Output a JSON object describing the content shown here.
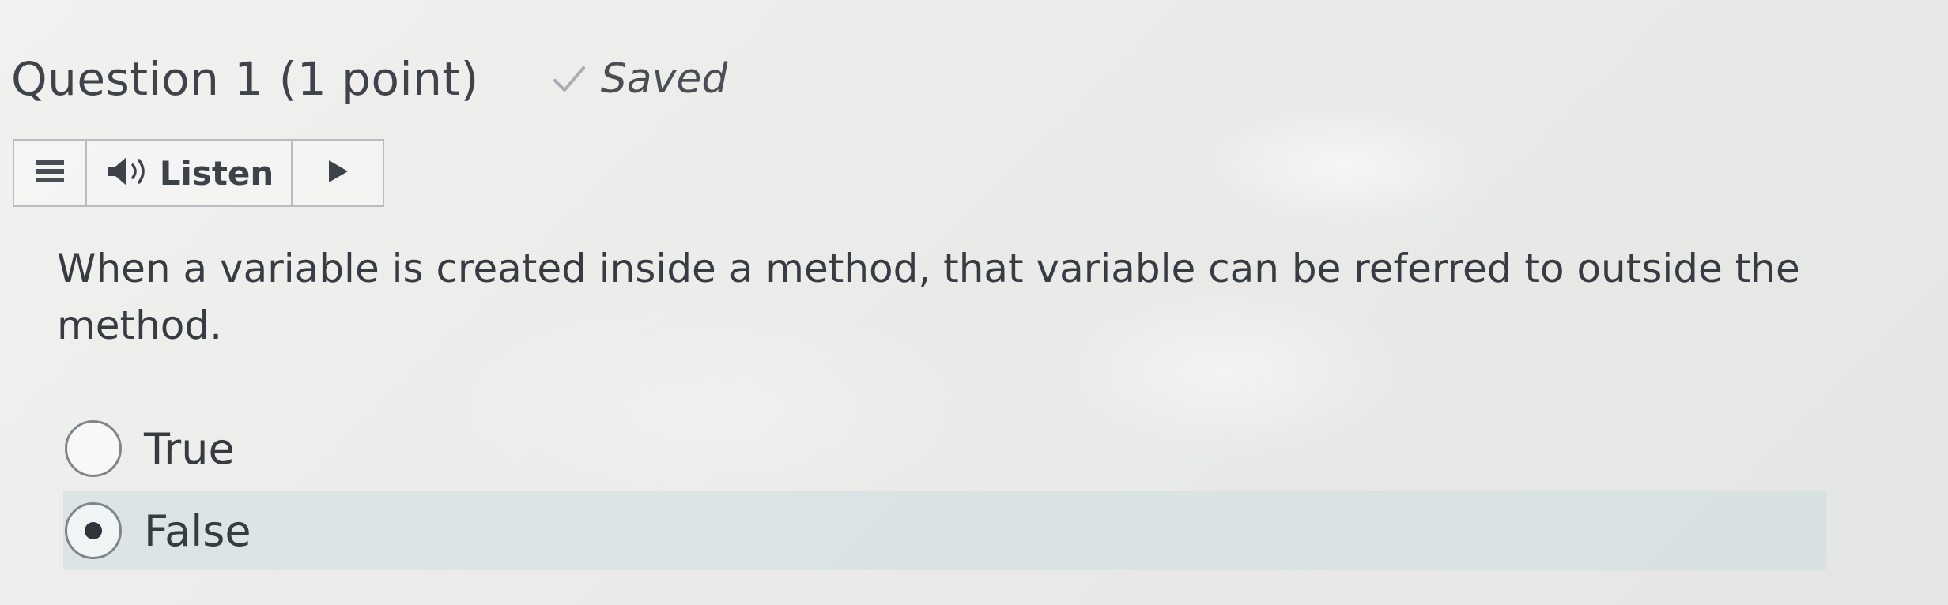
{
  "question": {
    "title": "Question 1 (1 point)",
    "status": "Saved",
    "text": "When a variable is created inside a method, that variable can be referred to outside the method."
  },
  "toolbar": {
    "menu_icon": "menu-icon",
    "listen_icon": "speaker-icon",
    "listen_label": "Listen",
    "play_icon": "play-icon"
  },
  "options": [
    {
      "label": "True",
      "selected": false
    },
    {
      "label": "False",
      "selected": true
    }
  ],
  "colors": {
    "text": "#373b42",
    "selected_row": "#cddce0",
    "radio_border": "#7f858c",
    "check": "#a9adb2"
  }
}
